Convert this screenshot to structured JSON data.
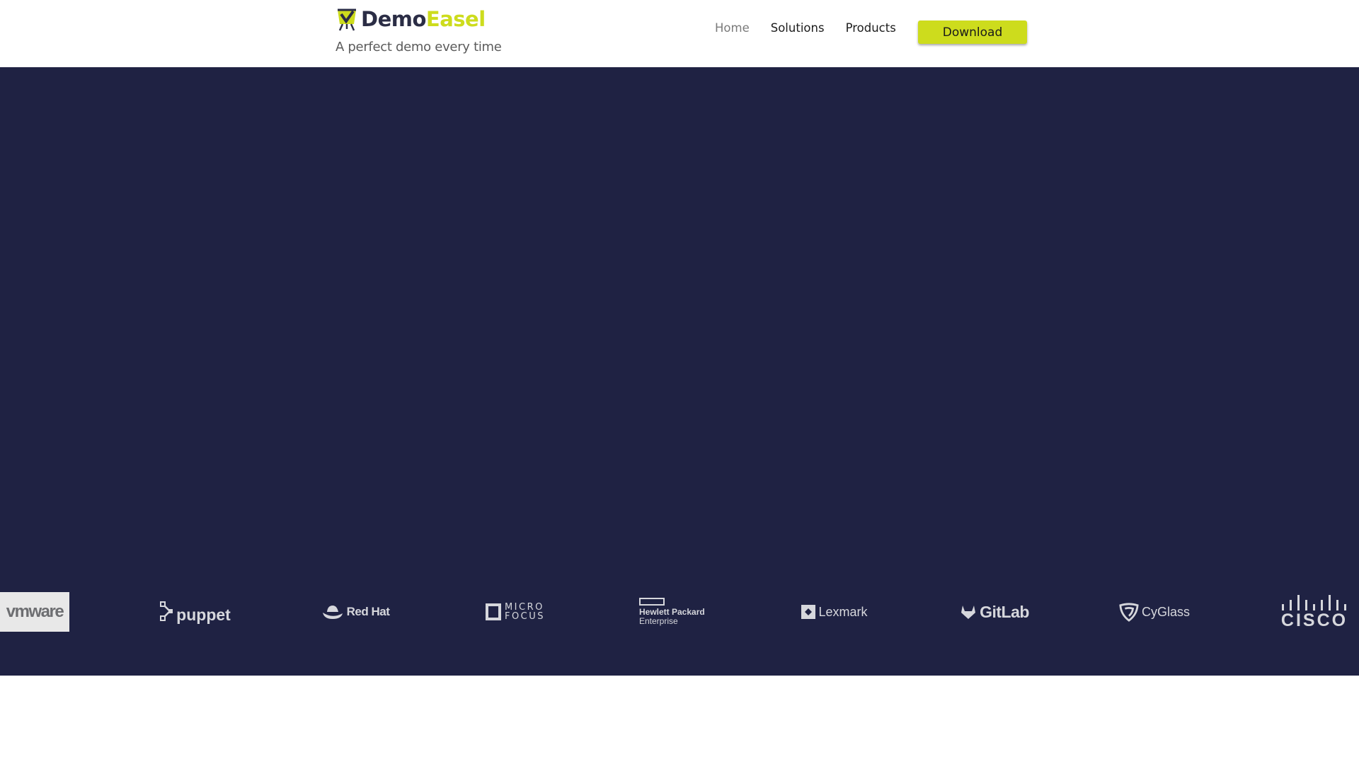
{
  "brand": {
    "name_part1": "Demo",
    "name_part2": "Easel",
    "tagline": "A perfect demo every time",
    "icon": "easel-checkmark-logo"
  },
  "nav": {
    "items": [
      {
        "label": "Home",
        "active": true
      },
      {
        "label": "Solutions",
        "active": false
      },
      {
        "label": "Products",
        "active": false
      }
    ],
    "download_label": "Download"
  },
  "partners": {
    "logos": [
      {
        "name": "vmware",
        "text": "vmware"
      },
      {
        "name": "puppet",
        "text": "puppet"
      },
      {
        "name": "red-hat",
        "text": "Red Hat"
      },
      {
        "name": "micro-focus",
        "text_line1": "MICRO",
        "text_line2": "FOCUS"
      },
      {
        "name": "hewlett-packard-enterprise",
        "text_line1": "Hewlett Packard",
        "text_line2": "Enterprise"
      },
      {
        "name": "lexmark",
        "text": "Lexmark"
      },
      {
        "name": "gitlab",
        "text": "GitLab"
      },
      {
        "name": "cyglass",
        "text": "CyGlass"
      },
      {
        "name": "cisco",
        "text": "CISCO"
      }
    ]
  },
  "colors": {
    "accent": "#cddc1d",
    "brand_dark": "#2b2d45",
    "hero_background": "#1f2243",
    "logo_color": "#d6d7dc"
  }
}
